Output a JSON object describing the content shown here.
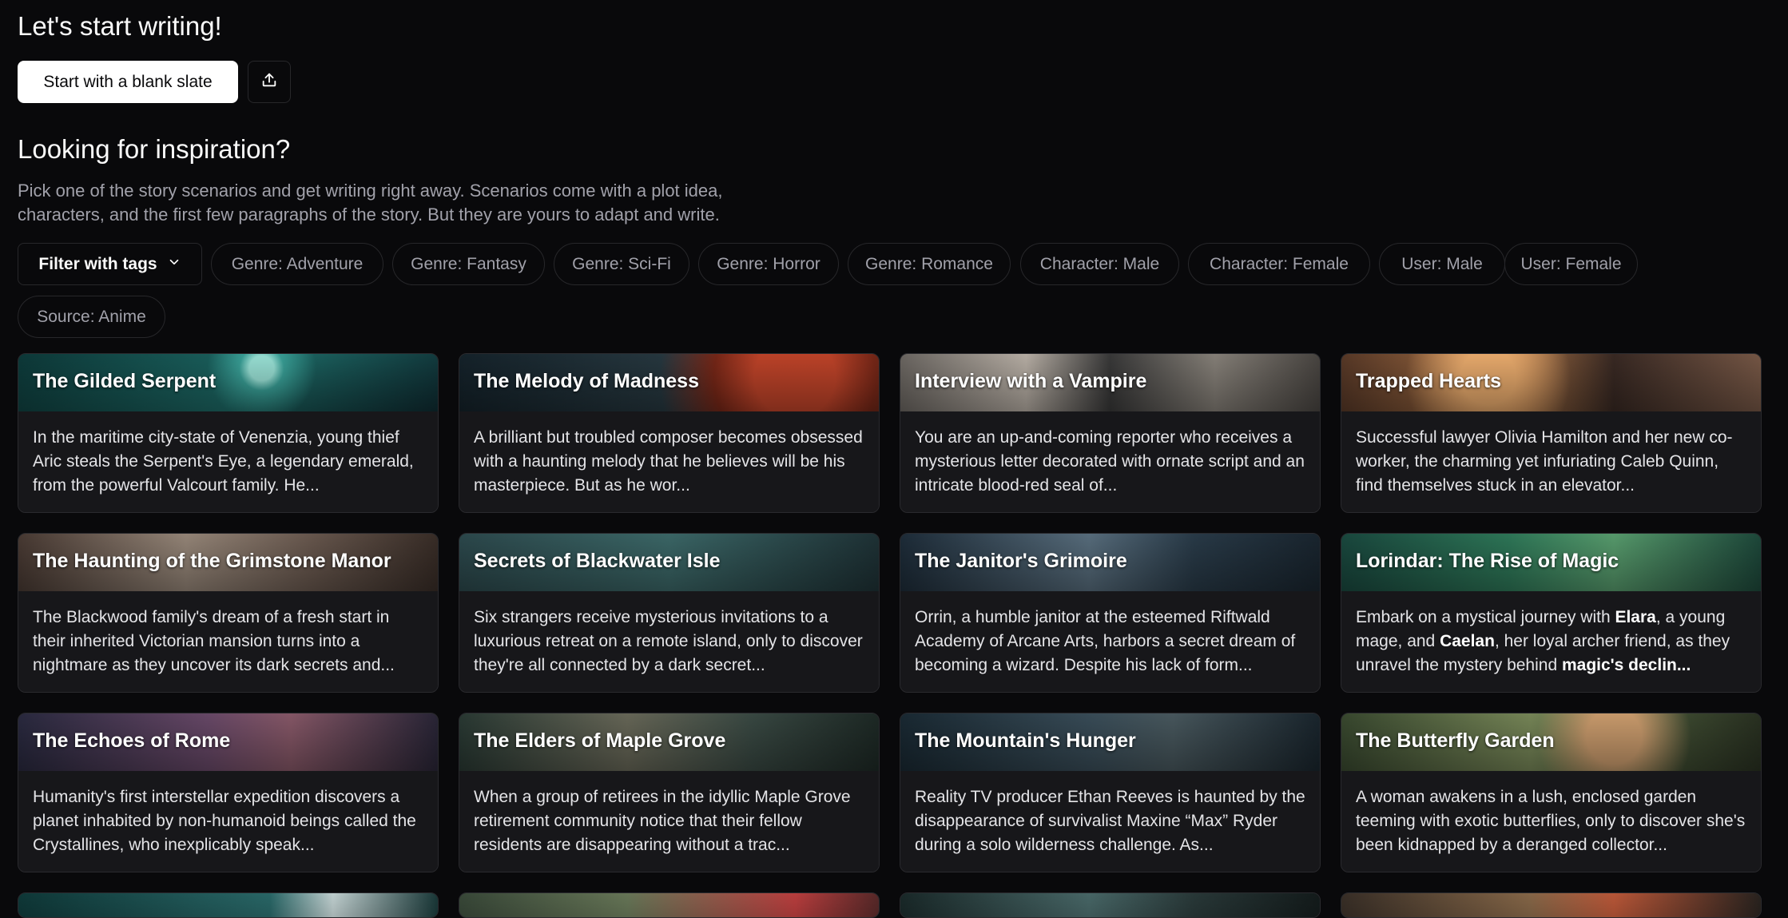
{
  "header": {
    "title": "Let's start writing!",
    "blank_button": "Start with a blank slate",
    "upload_icon": "upload-icon"
  },
  "inspiration": {
    "title": "Looking for inspiration?",
    "description": "Pick one of the story scenarios and get writing right away. Scenarios come with a plot idea, characters, and the first few paragraphs of the story. But they are yours to adapt and write."
  },
  "filter": {
    "label": "Filter with tags",
    "icon": "chevron-down-icon"
  },
  "tags": [
    "Genre: Adventure",
    "Genre: Fantasy",
    "Genre: Sci-Fi",
    "Genre: Horror",
    "Genre: Romance",
    "Character: Male",
    "Character: Female",
    "User: Male",
    "User: Female",
    "Source: Anime"
  ],
  "cards": [
    {
      "title": "The Gilded Serpent",
      "text": "In the maritime city-state of Venenzia, young thief Aric steals the Serpent's Eye, a legendary emerald, from the powerful Valcourt family. He..."
    },
    {
      "title": "The Melody of Madness",
      "text": "A brilliant but troubled composer becomes obsessed with a haunting melody that he believes will be his masterpiece. But as he wor..."
    },
    {
      "title": "Interview with a Vampire",
      "text": "You are an up-and-coming reporter who receives a mysterious letter decorated with ornate script and an intricate blood-red seal of..."
    },
    {
      "title": "Trapped Hearts",
      "text": "Successful lawyer Olivia Hamilton and her new co-worker, the charming yet infuriating Caleb Quinn, find themselves stuck in an elevator..."
    },
    {
      "title": "The Haunting of the Grimstone Manor",
      "text": "The Blackwood family's dream of a fresh start in their inherited Victorian mansion turns into a nightmare as they uncover its dark secrets and..."
    },
    {
      "title": "Secrets of Blackwater Isle",
      "text": "Six strangers receive mysterious invitations to a luxurious retreat on a remote island, only to discover they're all connected by a dark secret..."
    },
    {
      "title": "The Janitor's Grimoire",
      "text": "Orrin, a humble janitor at the esteemed Riftwald Academy of Arcane Arts, harbors a secret dream of becoming a wizard. Despite his lack of form..."
    },
    {
      "title": "Lorindar: The Rise of Magic",
      "text_parts": [
        "Embark on a mystical journey with ",
        "Elara",
        ", a young mage, and ",
        "Caelan",
        ", her loyal archer friend, as they unravel the mystery behind ",
        "magic's declin..."
      ]
    },
    {
      "title": "The Echoes of Rome",
      "text": "Humanity's first interstellar expedition discovers a planet inhabited by non-humanoid beings called the Crystallines, who inexplicably speak..."
    },
    {
      "title": "The Elders of Maple Grove",
      "text": "When a group of retirees in the idyllic Maple Grove retirement community notice that their fellow residents are disappearing without a trac..."
    },
    {
      "title": "The Mountain's Hunger",
      "text": "Reality TV producer Ethan Reeves is haunted by the disappearance of survivalist Maxine “Max” Ryder during a solo wilderness challenge. As..."
    },
    {
      "title": "The Butterfly Garden",
      "text": "A woman awakens in a lush, enclosed garden teeming with exotic butterflies, only to discover she's been kidnapped by a deranged collector..."
    }
  ],
  "colors": {
    "background": "#09090b",
    "border": "#27272a",
    "muted_text": "#a1a1aa"
  }
}
